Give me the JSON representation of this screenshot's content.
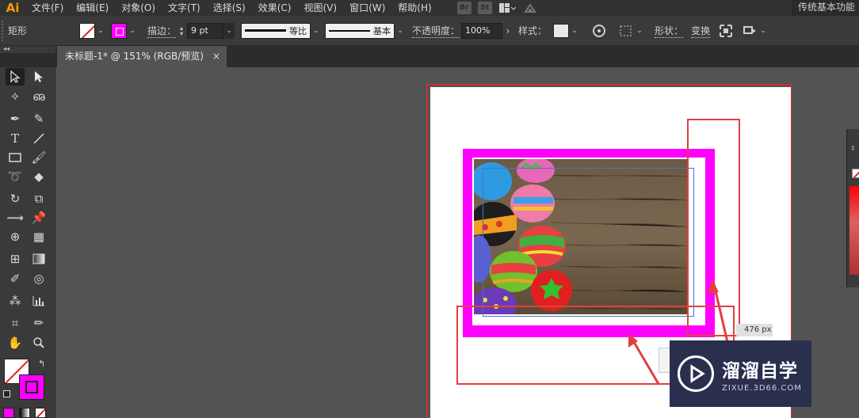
{
  "app": {
    "logo": "Ai",
    "accent": "#ff9a00"
  },
  "menu": {
    "items": [
      "文件(F)",
      "编辑(E)",
      "对象(O)",
      "文字(T)",
      "选择(S)",
      "效果(C)",
      "视图(V)",
      "窗口(W)",
      "帮助(H)"
    ],
    "badges": [
      "Br",
      "St"
    ],
    "workspace": "传统基本功能"
  },
  "control": {
    "object_type": "矩形",
    "fill": "none",
    "stroke_color": "#ff00ff",
    "stroke_label": "描边：",
    "stroke_weight": "9 pt",
    "profile_uniform": "等比",
    "brush_basic": "基本",
    "opacity_label": "不透明度：",
    "opacity_value": "100%",
    "style_label": "样式：",
    "shape_label": "形状：",
    "transform_label": "变换"
  },
  "panel": {
    "collapse": "◂◂",
    "doc_tab": "未标题-1* @ 151% (RGB/预览)",
    "doc_close": "×"
  },
  "canvas": {
    "frame_color": "#ff00ff",
    "annotation_color": "#e04040",
    "tooltip": "476 px"
  },
  "watermark": {
    "title": "溜溜自学",
    "url": "ZIXUE.3D66.COM"
  }
}
